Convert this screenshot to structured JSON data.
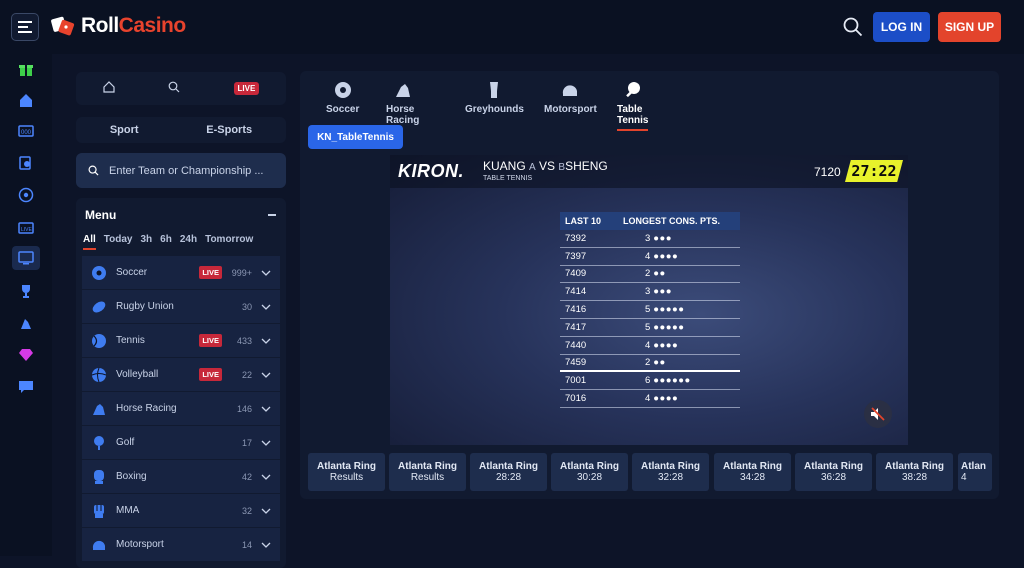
{
  "brand": {
    "name_a": "Roll",
    "name_b": "Casino"
  },
  "header": {
    "login_label": "LOG IN",
    "signup_label": "SIGN UP"
  },
  "rail": [
    "gift-icon",
    "home-icon",
    "scoreboard-icon",
    "virtual-sports-icon",
    "soccer-ball-icon",
    "live-tv-icon",
    "monitor-icon",
    "trophy-icon",
    "horse-racing-icon",
    "diamond-icon",
    "chat-icon"
  ],
  "quickbar": {
    "live_label": "LIVE"
  },
  "sport_toggle": {
    "sport": "Sport",
    "esports": "E-Sports"
  },
  "search": {
    "placeholder": "Enter Team or Championship ..."
  },
  "menu": {
    "title": "Menu",
    "filters": [
      "All",
      "Today",
      "3h",
      "6h",
      "24h",
      "Tomorrow"
    ],
    "items": [
      {
        "name": "Soccer",
        "live": "LIVE",
        "count": "999+"
      },
      {
        "name": "Rugby Union",
        "live": "",
        "count": "30"
      },
      {
        "name": "Tennis",
        "live": "LIVE",
        "count": "433"
      },
      {
        "name": "Volleyball",
        "live": "LIVE",
        "count": "22"
      },
      {
        "name": "Horse Racing",
        "live": "",
        "count": "146"
      },
      {
        "name": "Golf",
        "live": "",
        "count": "17"
      },
      {
        "name": "Boxing",
        "live": "",
        "count": "42"
      },
      {
        "name": "MMA",
        "live": "",
        "count": "32"
      },
      {
        "name": "Motorsport",
        "live": "",
        "count": "14"
      }
    ]
  },
  "tabs": [
    {
      "label": "Soccer"
    },
    {
      "label": "Horse Racing"
    },
    {
      "label": "Greyhounds"
    },
    {
      "label": "Motorsport"
    },
    {
      "label": "Table Tennis"
    }
  ],
  "provider_button": "KN_TableTennis",
  "video": {
    "brand": "KIRON.",
    "player_a": "KUANG",
    "tag_a": "A",
    "vs": "VS",
    "tag_b": "B",
    "player_b": "SHENG",
    "subtitle": "TABLE TENNIS",
    "game_id": "7120",
    "timer": "27:22",
    "table": {
      "col1": "LAST 10",
      "col2": "LONGEST CONS. PTS.",
      "rows": [
        {
          "id": "7392",
          "pts": "3",
          "dots": "●●●"
        },
        {
          "id": "7397",
          "pts": "4",
          "dots": "●●●●"
        },
        {
          "id": "7409",
          "pts": "2",
          "dots": "●●"
        },
        {
          "id": "7414",
          "pts": "3",
          "dots": "●●●"
        },
        {
          "id": "7416",
          "pts": "5",
          "dots": "●●●●●"
        },
        {
          "id": "7417",
          "pts": "5",
          "dots": "●●●●●"
        },
        {
          "id": "7440",
          "pts": "4",
          "dots": "●●●●"
        },
        {
          "id": "7459",
          "pts": "2",
          "dots": "●●"
        },
        {
          "id": "7001",
          "pts": "6",
          "dots": "●●●●●●"
        },
        {
          "id": "7016",
          "pts": "4",
          "dots": "●●●●"
        }
      ]
    }
  },
  "events": [
    {
      "title": "Atlanta Ring",
      "sub": "Results"
    },
    {
      "title": "Atlanta Ring",
      "sub": "Results"
    },
    {
      "title": "Atlanta Ring",
      "sub": "28:28"
    },
    {
      "title": "Atlanta Ring",
      "sub": "30:28"
    },
    {
      "title": "Atlanta Ring",
      "sub": "32:28"
    },
    {
      "title": "Atlanta Ring",
      "sub": "34:28"
    },
    {
      "title": "Atlanta Ring",
      "sub": "36:28"
    },
    {
      "title": "Atlanta Ring",
      "sub": "38:28"
    },
    {
      "title": "Atlan",
      "sub": "4"
    }
  ]
}
